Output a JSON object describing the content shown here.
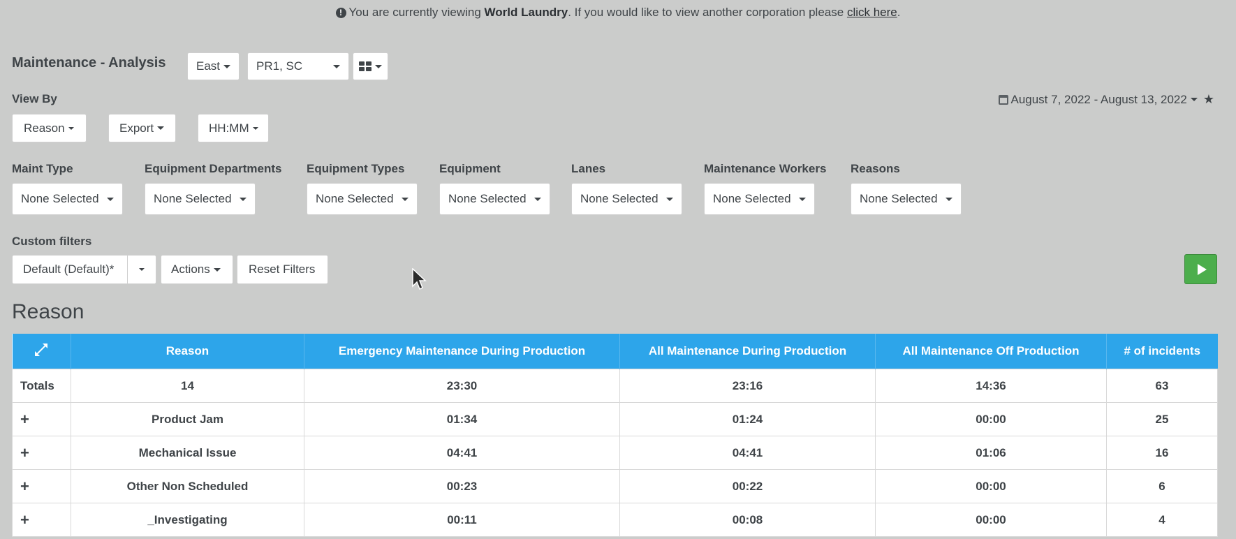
{
  "notice": {
    "prefix": "You are currently viewing",
    "corporation": "World Laundry",
    "middle": ". If you would like to view another corporation please",
    "link": "click here",
    "suffix": "."
  },
  "header": {
    "title": "Maintenance - Analysis",
    "region": "East",
    "plants": "PR1, SC"
  },
  "view_by": {
    "label": "View By",
    "reason_btn": "Reason",
    "export_btn": "Export",
    "format_btn": "HH:MM"
  },
  "date_range": "August 7, 2022 - August 13, 2022",
  "filters": [
    {
      "label": "Maint Type",
      "value": "None Selected"
    },
    {
      "label": "Equipment Departments",
      "value": "None Selected"
    },
    {
      "label": "Equipment Types",
      "value": "None Selected"
    },
    {
      "label": "Equipment",
      "value": "None Selected"
    },
    {
      "label": "Lanes",
      "value": "None Selected"
    },
    {
      "label": "Maintenance Workers",
      "value": "None Selected"
    },
    {
      "label": "Reasons",
      "value": "None Selected"
    }
  ],
  "custom_filters": {
    "label": "Custom filters",
    "selected": "Default (Default)*",
    "actions": "Actions",
    "reset": "Reset Filters"
  },
  "section_title": "Reason",
  "table": {
    "headers": [
      "Reason",
      "Emergency Maintenance During Production",
      "All Maintenance During Production",
      "All Maintenance Off Production",
      "# of incidents"
    ],
    "totals": {
      "label": "Totals",
      "values": [
        "14",
        "23:30",
        "23:16",
        "14:36",
        "63"
      ]
    },
    "rows": [
      {
        "expander": "+",
        "values": [
          "Product Jam",
          "01:34",
          "01:24",
          "00:00",
          "25"
        ]
      },
      {
        "expander": "+",
        "values": [
          "Mechanical Issue",
          "04:41",
          "04:41",
          "01:06",
          "16"
        ]
      },
      {
        "expander": "+",
        "values": [
          "Other Non Scheduled",
          "00:23",
          "00:22",
          "00:00",
          "6"
        ]
      },
      {
        "expander": "+",
        "values": [
          "_Investigating",
          "00:11",
          "00:08",
          "00:00",
          "4"
        ]
      }
    ]
  },
  "colors": {
    "background": "#cbcccb",
    "table_header": "#2da5ea",
    "run_button": "#4cae4c"
  }
}
